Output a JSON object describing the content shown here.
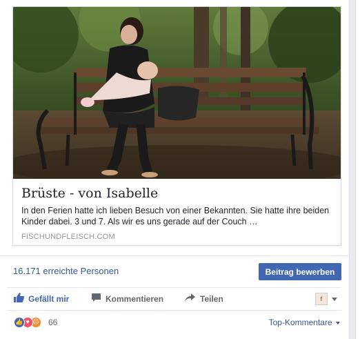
{
  "preview": {
    "title": "Brüste - von Isabelle",
    "description": "In den Ferien hatte ich lieben Besuch von einer Bekannten. Sie hatte ihre beiden Kinder dabei. 3 und 7. Als wir es uns gerade auf der Couch …",
    "domain": "FISCHUNDFLEISCH.COM",
    "image_icon": "photo-of-mother-breastfeeding-on-park-bench"
  },
  "stats": {
    "reach": "16.171 erreichte Personen",
    "boost_label": "Beitrag bewerben"
  },
  "actions": {
    "like": "Gefällt mir",
    "comment": "Kommentieren",
    "share": "Teilen",
    "reactor_selector": "f▾"
  },
  "reactions": {
    "count": "66",
    "sort_label": "Top-Kommentare",
    "colors": {
      "like": "#4267b2",
      "love": "#f25268",
      "angry": "#f28b30",
      "brand": "#4267b2"
    }
  }
}
